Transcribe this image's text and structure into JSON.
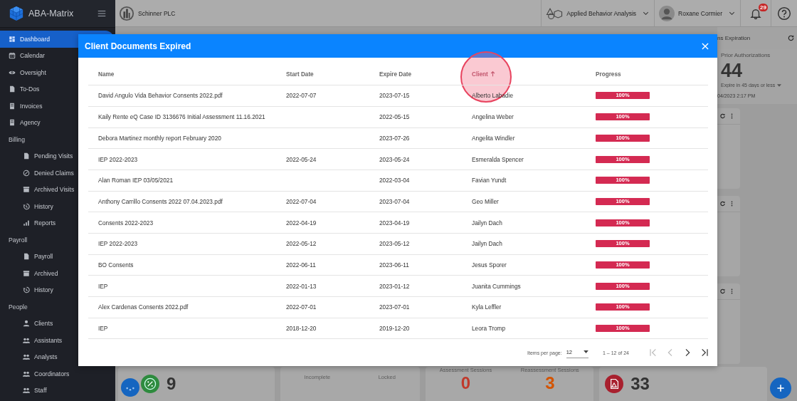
{
  "app": {
    "name": "ABA-Matrix"
  },
  "sidebar": {
    "items": [
      {
        "label": "Dashboard",
        "selected": true
      },
      {
        "label": "Calendar",
        "selected": false
      },
      {
        "label": "Oversight",
        "selected": false
      },
      {
        "label": "To-Dos",
        "selected": false
      },
      {
        "label": "Invoices",
        "selected": false
      },
      {
        "label": "Agency",
        "selected": false
      }
    ],
    "groups": [
      {
        "title": "Billing",
        "items": [
          {
            "label": "Pending Visits",
            "selected": false
          },
          {
            "label": "Denied Claims",
            "selected": false
          },
          {
            "label": "Archived Visits",
            "selected": false
          },
          {
            "label": "History",
            "selected": false
          },
          {
            "label": "Reports",
            "selected": false
          }
        ]
      },
      {
        "title": "Payroll",
        "items": [
          {
            "label": "Payroll",
            "selected": false
          },
          {
            "label": "Archived",
            "selected": false
          },
          {
            "label": "History",
            "selected": false
          }
        ]
      },
      {
        "title": "People",
        "items": [
          {
            "label": "Clients",
            "selected": false
          },
          {
            "label": "Assistants",
            "selected": false
          },
          {
            "label": "Analysts",
            "selected": false
          },
          {
            "label": "Coordinators",
            "selected": false
          },
          {
            "label": "Staff",
            "selected": false
          }
        ]
      }
    ]
  },
  "topbar": {
    "organization": "Schinner PLC",
    "practice": "Applied Behavior Analysis",
    "user": "Roxane Cormier",
    "notifications": "29"
  },
  "dashboard": {
    "section_title": "ns Expiration",
    "card": {
      "title": "Prior Authorizations",
      "value": "44",
      "filter": "Expire in 45 days or less",
      "updated": "04/2023 2:17 PM"
    },
    "stats": [
      {
        "value": "9"
      },
      {
        "labels": [
          "Incomplete",
          "Locked"
        ]
      },
      {
        "labels": [
          "Assessment Sessions",
          "Reassessment Sessions"
        ],
        "values": [
          {
            "value": "0",
            "color": "#c0392b"
          },
          {
            "value": "3",
            "color": "#d35400"
          }
        ]
      },
      {
        "value": "33"
      }
    ]
  },
  "modal": {
    "title": "Client Documents Expired",
    "columns": [
      {
        "label": "Name",
        "sorted": false
      },
      {
        "label": "Start Date",
        "sorted": false
      },
      {
        "label": "Expire Date",
        "sorted": false
      },
      {
        "label": "Client",
        "sorted": true
      },
      {
        "label": "Progress",
        "sorted": false
      }
    ],
    "rows": [
      {
        "name": "David Angulo Vida Behavior Consents 2022.pdf",
        "start_date": "2022-07-07",
        "expire_date": "2023-07-15",
        "client": "Alberto Labadie",
        "level": 1,
        "progress": "100%"
      },
      {
        "name": "Kaily Rente eQ Case ID 3136676 Initial Assessment 11.16.2021",
        "expire_date": "2022-05-15",
        "client": "Angelina Weber",
        "level": 1,
        "progress": "100%"
      },
      {
        "name": "Debora Martinez monthly report February 2020",
        "expire_date": "2023-07-26",
        "client": "Angelita Windler",
        "level": 1,
        "progress": "100%"
      },
      {
        "name": "IEP 2022-2023",
        "start_date": "2022-05-24",
        "expire_date": "2023-05-24",
        "client": "Esmeralda Spencer",
        "level": 1,
        "progress": "100%"
      },
      {
        "name": "Alan Roman IEP 03/05/2021",
        "expire_date": "2022-03-04",
        "client": "Favian Yundt",
        "level": 1,
        "progress": "100%"
      },
      {
        "name": "Anthony Carrillo Consents 2022 07.04.2023.pdf",
        "start_date": "2022-07-04",
        "expire_date": "2023-07-04",
        "client": "Geo Miller",
        "level": 1,
        "progress": "100%"
      },
      {
        "name": "Consents 2022-2023",
        "start_date": "2022-04-19",
        "expire_date": "2023-04-19",
        "client": "Jailyn Dach",
        "level": 1,
        "progress": "100%"
      },
      {
        "name": "IEP 2022-2023",
        "start_date": "2022-05-12",
        "expire_date": "2023-05-12",
        "client": "Jailyn Dach",
        "level": 1,
        "progress": "100%"
      },
      {
        "name": "BO Consents",
        "start_date": "2022-06-11",
        "expire_date": "2023-06-11",
        "client": "Jesus Sporer",
        "level": 1,
        "progress": "100%"
      },
      {
        "name": "IEP",
        "start_date": "2022-01-13",
        "expire_date": "2023-01-12",
        "client": "Juanita Cummings",
        "level": 1,
        "progress": "100%"
      },
      {
        "name": "Alex Cardenas Consents 2022.pdf",
        "start_date": "2022-07-01",
        "expire_date": "2023-07-01",
        "client": "Kyla Leffler",
        "level": 1,
        "progress": "100%"
      },
      {
        "name": "IEP",
        "start_date": "2018-12-20",
        "expire_date": "2019-12-20",
        "client": "Leora Tromp",
        "level": 1,
        "progress": "100%"
      }
    ],
    "paginator": {
      "label": "Items per page:",
      "page_size": "12",
      "range": "1 – 12 of 24"
    },
    "click_marker": true
  }
}
